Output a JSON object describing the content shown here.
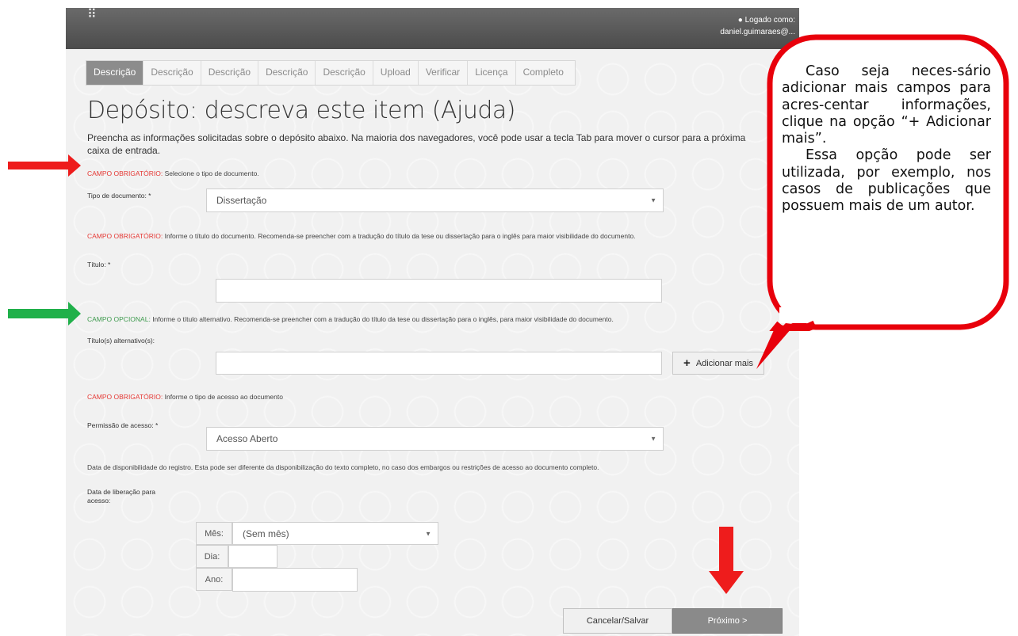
{
  "navbar": {
    "brand_glyph": "⠿",
    "user_label": "Logado como:",
    "user_email": "daniel.guimaraes@..."
  },
  "tabs": [
    {
      "label": "Descrição",
      "active": true
    },
    {
      "label": "Descrição"
    },
    {
      "label": "Descrição"
    },
    {
      "label": "Descrição"
    },
    {
      "label": "Descrição"
    },
    {
      "label": "Upload"
    },
    {
      "label": "Verificar"
    },
    {
      "label": "Licença"
    },
    {
      "label": "Completo"
    }
  ],
  "title": "Depósito: descreva este item (Ajuda)",
  "intro": "Preencha as informações solicitadas sobre o depósito abaixo. Na maioria dos navegadores, você pode usar a tecla Tab para mover o cursor para a próxima caixa de entrada.",
  "fields": {
    "doc_type": {
      "note_tag": "CAMPO OBRIGATÓRIO:",
      "note_text": " Selecione o tipo de documento.",
      "label": "Tipo de documento: *",
      "value": "Dissertação"
    },
    "title": {
      "note_tag": "CAMPO OBRIGATÓRIO:",
      "note_text": " Informe o título do documento. Recomenda-se preencher com a tradução do título da tese ou dissertação para o inglês para maior visibilidade do documento.",
      "label": "Título: *",
      "value": ""
    },
    "alt_title": {
      "note_tag": "CAMPO OPCIONAL:",
      "note_text": " Informe o título alternativo. Recomenda-se preencher com a tradução do título da tese ou dissertação para o inglês, para maior visibilidade do documento.",
      "label": "Título(s) alternativo(s):",
      "value": "",
      "add_more_label": "Adicionar mais"
    },
    "access": {
      "note_tag": "CAMPO OBRIGATÓRIO:",
      "note_text": " Informe o tipo de acesso ao documento",
      "label": "Permissão de acesso: *",
      "value": "Acesso Aberto"
    },
    "release": {
      "note_text": "Data de disponibilidade do registro. Esta pode ser diferente da disponibilização do texto completo, no caso dos embargos ou restrições de acesso ao documento completo.",
      "label_line1": "Data de liberação para",
      "label_line2": "acesso:",
      "month_label": "Mês:",
      "month_value": "(Sem mês)",
      "day_label": "Dia:",
      "year_label": "Ano:"
    }
  },
  "buttons": {
    "cancel": "Cancelar/Salvar",
    "next": "Próximo >"
  },
  "callout": {
    "paragraph1": "Caso seja neces-sário adicionar mais campos para acres-centar informações, clique na opção “+ Adicionar mais”.",
    "paragraph2": "Essa opção pode ser utilizada, por exemplo, nos casos de publicações que possuem mais de um autor."
  },
  "colors": {
    "required_arrow": "#ee1c1c",
    "optional_arrow": "#20b04a",
    "callout_border": "#e8000b",
    "required_text": "#e53935",
    "optional_text": "#3f9b4f"
  }
}
